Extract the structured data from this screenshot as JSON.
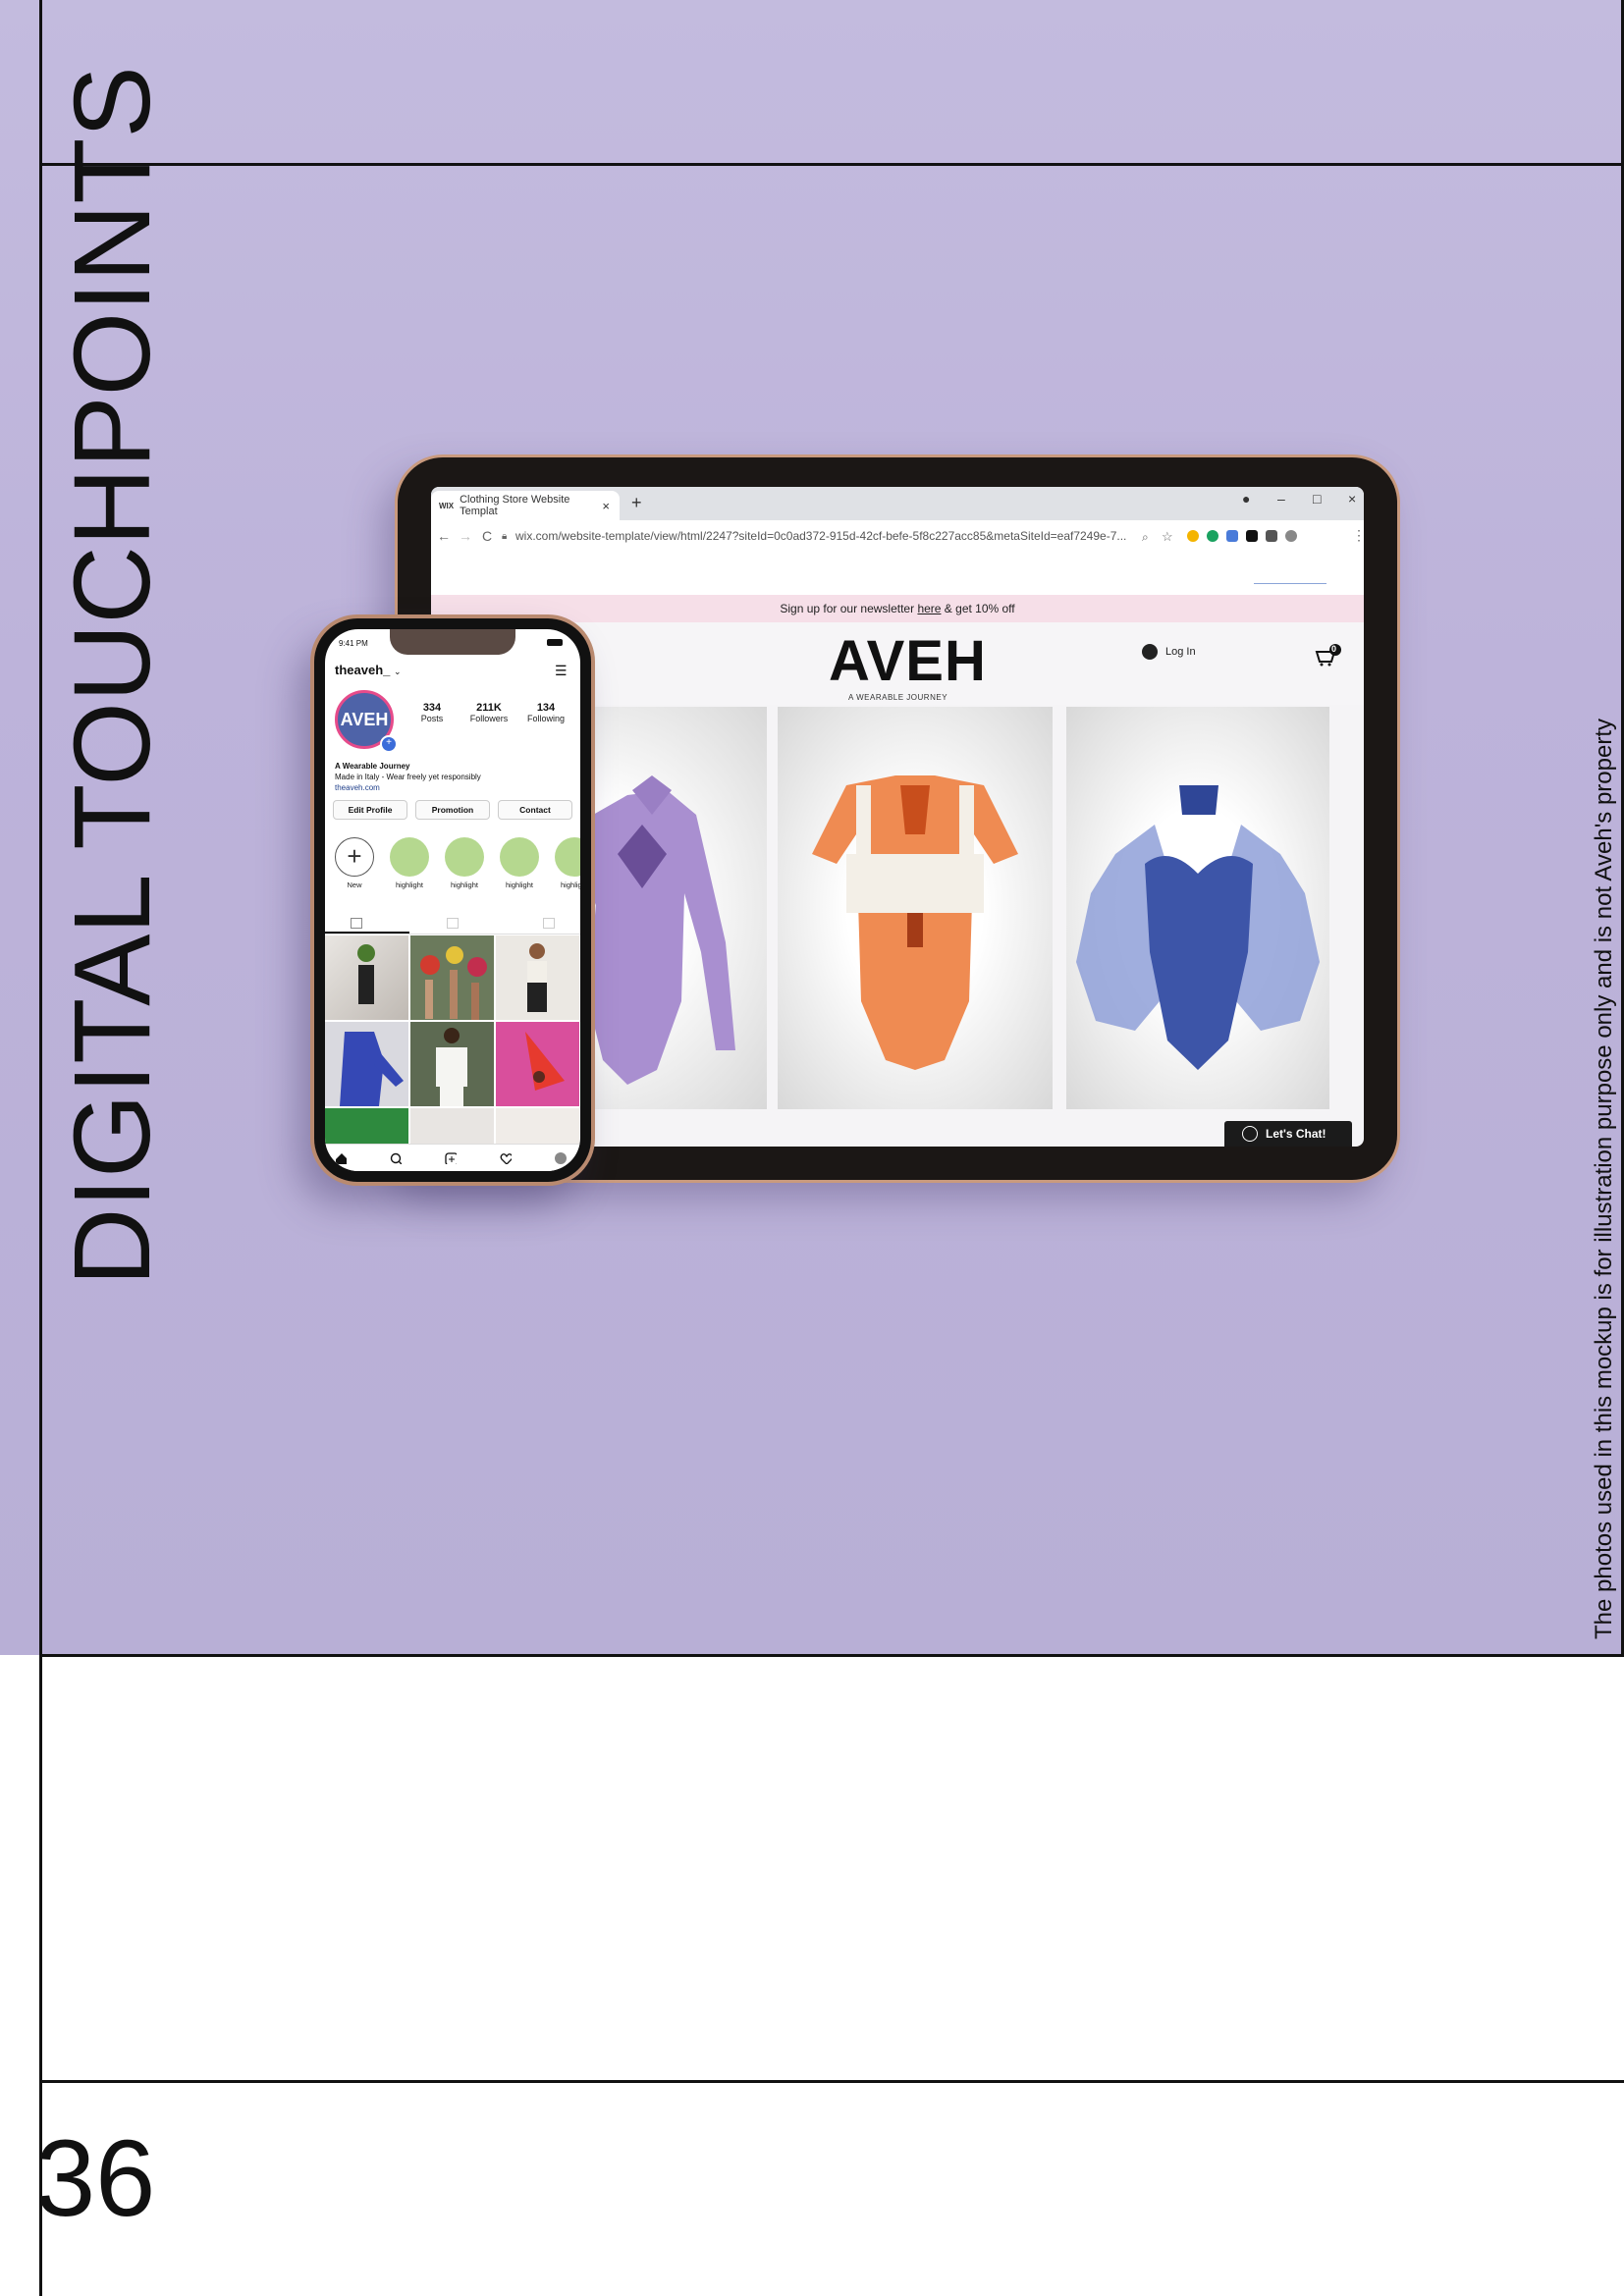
{
  "page": {
    "title": "DIGITAL TOUCHPOINTS",
    "disclaimer": "The photos used in this mockup is for illustration purpose only and is not Aveh's property",
    "page_number": "36"
  },
  "browser": {
    "tab_label": "Clothing Store Website Templat",
    "tab_favicon": "WIX",
    "new_tab": "+",
    "url": "wix.com/website-template/view/html/2247?siteId=0c0ad372-915d-42cf-befe-5f8c227acc85&metaSiteId=eaf7249e-7...",
    "back": "←",
    "forward": "→",
    "reload": "C"
  },
  "website": {
    "newsletter_pre": "Sign up for our newsletter ",
    "newsletter_link": "here",
    "newsletter_post": " & get 10% off",
    "logo": "AVEH",
    "tagline": "A WEARABLE JOURNEY",
    "login": "Log In",
    "cart_count": "0",
    "chat": "Let's Chat!",
    "products": [
      {
        "name": "lilac-collared-bodysuit",
        "color": "#a98fd0"
      },
      {
        "name": "orange-bandeau-bodysuit",
        "color": "#ef8b52"
      },
      {
        "name": "blue-corset-bodysuit",
        "color": "#3d55a8"
      }
    ]
  },
  "instagram": {
    "time": "9:41 PM",
    "username": "theaveh_",
    "username_chevron": "⌄",
    "avatar_text": "AVEH",
    "stats": [
      {
        "value": "334",
        "label": "Posts"
      },
      {
        "value": "211K",
        "label": "Followers"
      },
      {
        "value": "134",
        "label": "Following"
      }
    ],
    "bio_name": "A Wearable Journey",
    "bio_text": "Made in Italy - Wear freely yet responsibly",
    "bio_link": "theaveh.com",
    "buttons": [
      "Edit Profile",
      "Promotion",
      "Contact"
    ],
    "highlights": [
      "New",
      "highlight",
      "highlight",
      "highlight",
      "highlight"
    ]
  },
  "colors": {
    "background": "#bdb3da",
    "accent_pink": "#f6dfe8",
    "highlight_green": "#b5d88f"
  }
}
